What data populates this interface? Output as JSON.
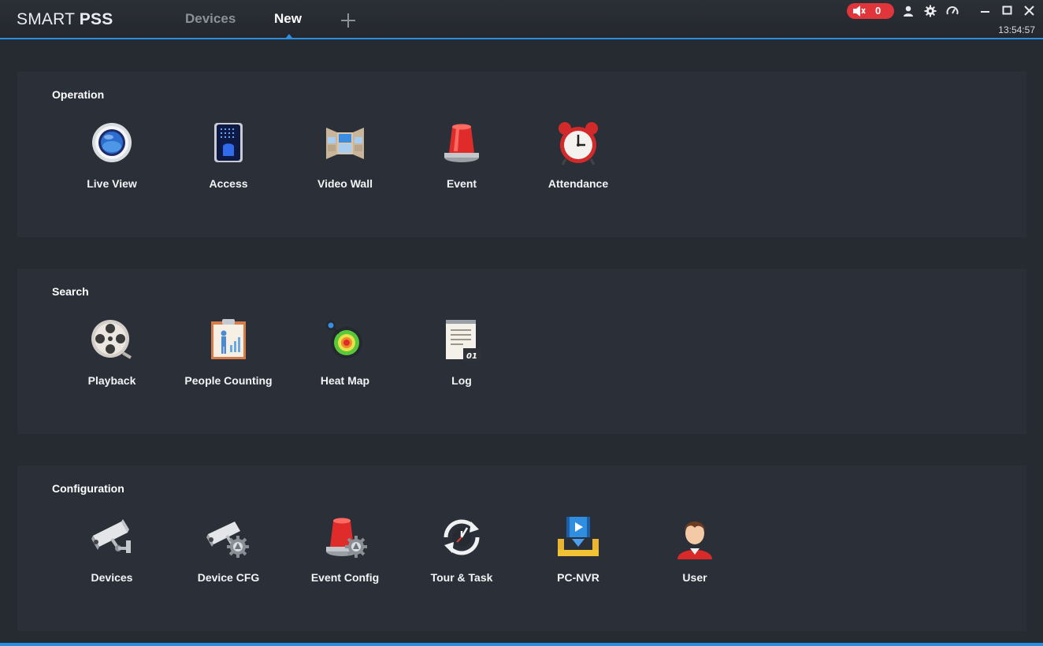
{
  "app": {
    "logo_light": "SMART ",
    "logo_bold": "PSS",
    "tabs": [
      {
        "label": "Devices",
        "active": false
      },
      {
        "label": "New",
        "active": true
      }
    ],
    "alarm_count": "0",
    "clock": "13:54:57",
    "colors": {
      "accent": "#2a8ee0",
      "alarm": "#e0353b",
      "background": "#262a31",
      "panel": "#2b3038"
    }
  },
  "titlebar_icons": [
    "speaker-icon",
    "user-icon",
    "gear-icon",
    "dashboard-icon",
    "minimize-icon",
    "maximize-icon",
    "close-icon"
  ],
  "sections": [
    {
      "title": "Operation",
      "modules": [
        {
          "label": "Live View",
          "icon": "live-view-icon"
        },
        {
          "label": "Access",
          "icon": "access-icon"
        },
        {
          "label": "Video Wall",
          "icon": "video-wall-icon"
        },
        {
          "label": "Event",
          "icon": "alarm-light-icon"
        },
        {
          "label": "Attendance",
          "icon": "alarm-clock-icon"
        }
      ]
    },
    {
      "title": "Search",
      "modules": [
        {
          "label": "Playback",
          "icon": "film-reel-icon"
        },
        {
          "label": "People Counting",
          "icon": "people-counting-icon"
        },
        {
          "label": "Heat Map",
          "icon": "heat-map-icon"
        },
        {
          "label": "Log",
          "icon": "log-icon",
          "icon_text": "01"
        }
      ]
    },
    {
      "title": "Configuration",
      "modules": [
        {
          "label": "Devices",
          "icon": "camera-icon"
        },
        {
          "label": "Device CFG",
          "icon": "camera-gear-icon"
        },
        {
          "label": "Event Config",
          "icon": "alarm-light-gear-icon"
        },
        {
          "label": "Tour & Task",
          "icon": "tour-task-icon"
        },
        {
          "label": "PC-NVR",
          "icon": "pc-nvr-icon"
        },
        {
          "label": "User",
          "icon": "user-avatar-icon"
        }
      ]
    }
  ]
}
